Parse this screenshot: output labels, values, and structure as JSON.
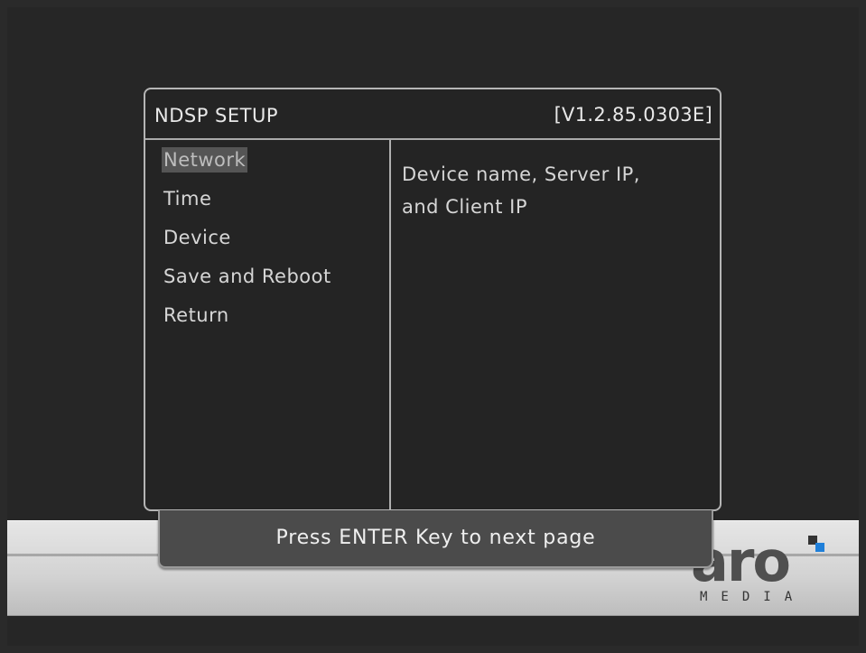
{
  "dialog": {
    "title": "NDSP SETUP",
    "version": "[V1.2.85.0303E]"
  },
  "menu": {
    "items": [
      {
        "label": "Network",
        "selected": true
      },
      {
        "label": "Time",
        "selected": false
      },
      {
        "label": "Device",
        "selected": false
      },
      {
        "label": "Save and Reboot",
        "selected": false
      },
      {
        "label": "Return",
        "selected": false
      }
    ]
  },
  "description": {
    "text": "Device name, Server IP,\n and Client IP"
  },
  "footer": {
    "prompt": "Press ENTER Key to next page"
  },
  "brand": {
    "logo_mark": "aro",
    "logo_word": "MEDIA",
    "accent_blue": "#1f7fd9"
  },
  "colors": {
    "background": "#262626",
    "panel": "#242424",
    "highlight": "#555555",
    "text": "#d6d6d6",
    "border": "#b5b5b5"
  }
}
